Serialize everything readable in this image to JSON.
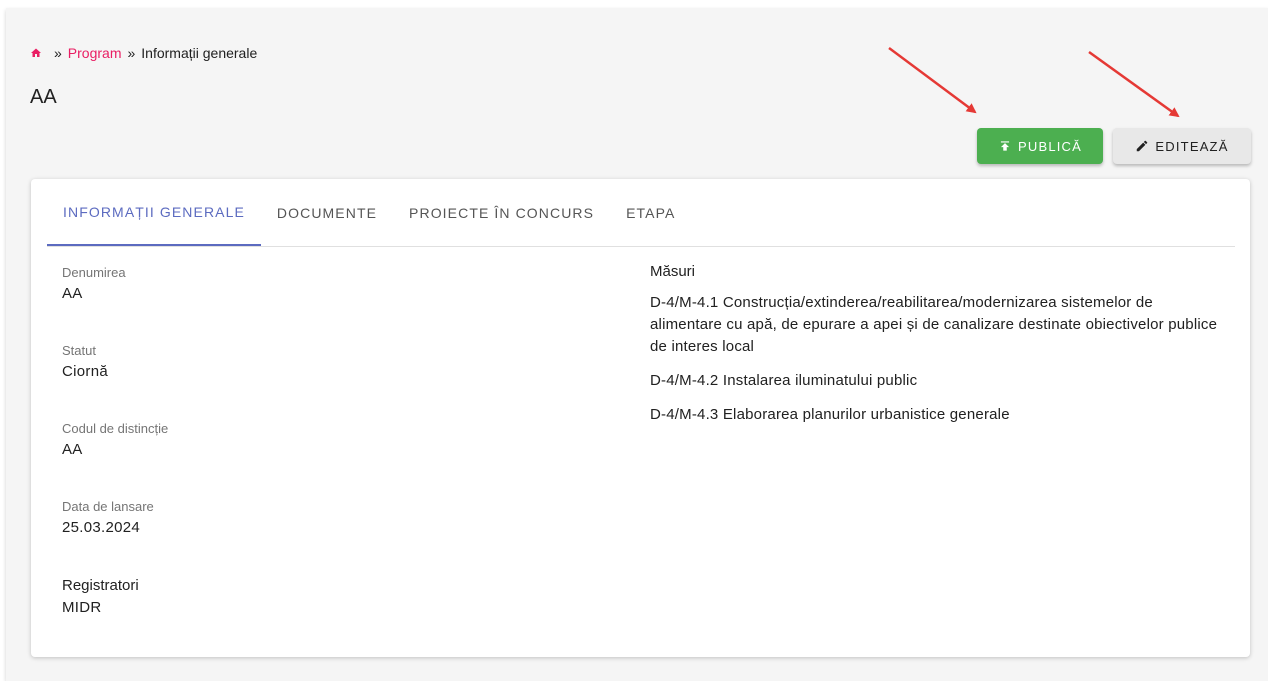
{
  "breadcrumb": {
    "home_icon": "home-icon",
    "separator": "»",
    "program": "Program",
    "current": "Informații generale"
  },
  "page": {
    "title": "AA"
  },
  "actions": {
    "publish_label": "PUBLICĂ",
    "publish_icon": "publish-upload-icon",
    "publish_color": "#4caf50",
    "edit_label": "EDITEAZĂ",
    "edit_icon": "pencil-icon"
  },
  "tabs": [
    {
      "label": "INFORMAȚII GENERALE",
      "active": true
    },
    {
      "label": "DOCUMENTE",
      "active": false
    },
    {
      "label": "PROIECTE ÎN CONCURS",
      "active": false
    },
    {
      "label": "ETAPA",
      "active": false
    }
  ],
  "fields": [
    {
      "label": "Denumirea",
      "value": "AA"
    },
    {
      "label": "Statut",
      "value": "Ciornă"
    },
    {
      "label": "Codul de distincție",
      "value": "AA"
    },
    {
      "label": "Data de lansare",
      "value": "25.03.2024"
    },
    {
      "label": "Registratori",
      "value": "MIDR"
    }
  ],
  "measures": {
    "heading": "Măsuri",
    "items": [
      "D-4/M-4.1 Construcția/extinderea/reabilitarea/modernizarea sistemelor de alimentare cu apă, de epurare a apei și de canalizare destinate obiectivelor publice de interes local",
      "D-4/M-4.2 Instalarea iluminatului public",
      "D-4/M-4.3 Elaborarea planurilor urbanistice generale"
    ]
  },
  "colors": {
    "accent_tab": "#5c6bc0",
    "breadcrumb_link": "#e91e63",
    "annotation_arrow": "#e53935"
  }
}
